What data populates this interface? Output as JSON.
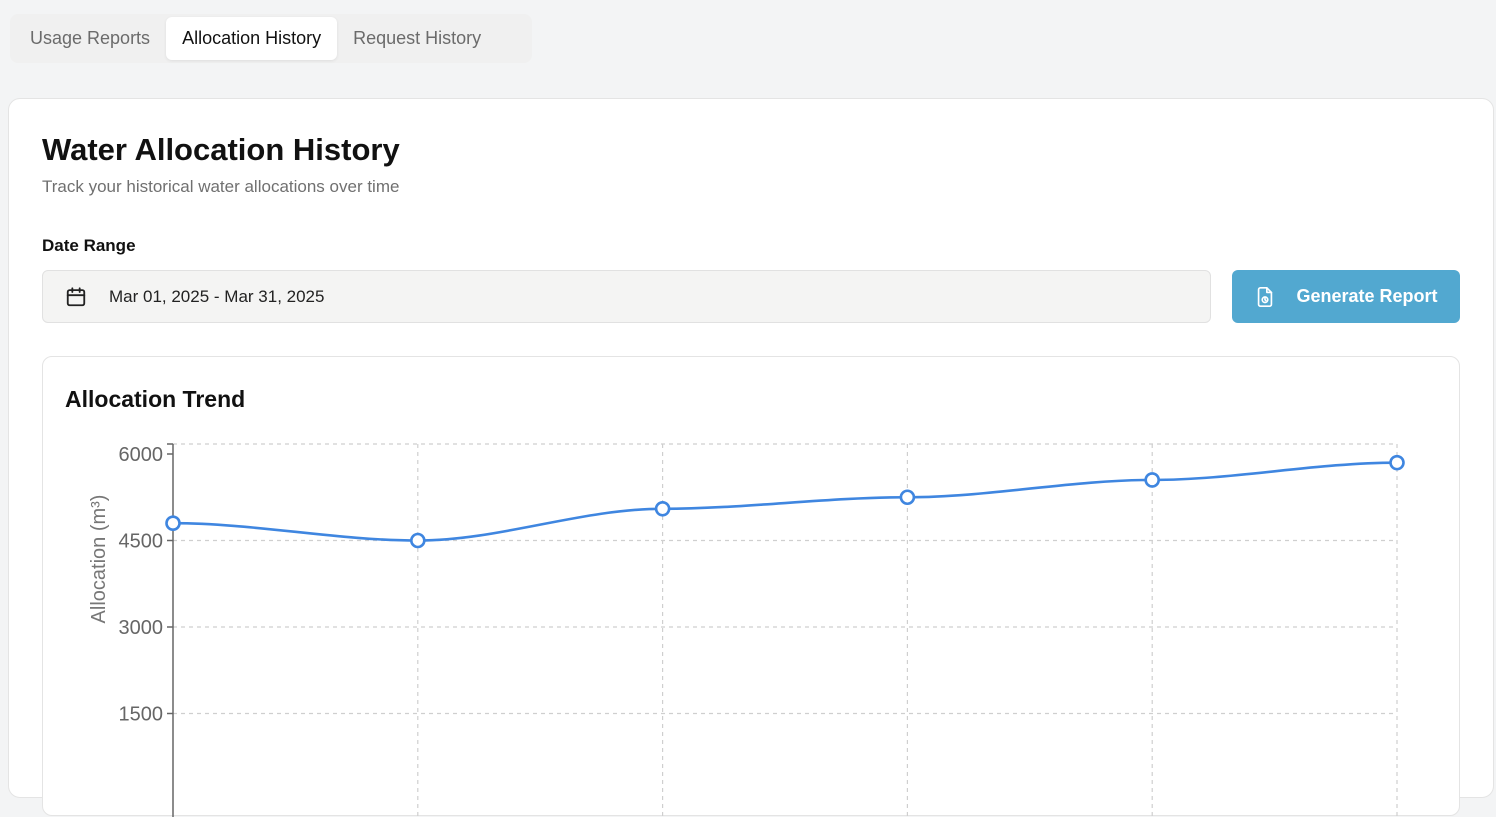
{
  "tabs": [
    {
      "label": "Usage Reports",
      "active": false
    },
    {
      "label": "Allocation History",
      "active": true
    },
    {
      "label": "Request History",
      "active": false
    }
  ],
  "page": {
    "title": "Water Allocation History",
    "subtitle": "Track your historical water allocations over time"
  },
  "date_range": {
    "label": "Date Range",
    "value": "Mar 01, 2025 - Mar 31, 2025",
    "icon": "calendar-icon"
  },
  "generate_button": {
    "label": "Generate Report",
    "icon": "report-file-icon"
  },
  "colors": {
    "accent": "#52a8d0",
    "line": "#3f86e0"
  },
  "chart_title": "Allocation Trend",
  "chart_data": {
    "type": "line",
    "title": "Allocation Trend",
    "xlabel": "",
    "ylabel": "Allocation (m³)",
    "ylim": [
      0,
      6000
    ],
    "y_ticks": [
      1500,
      3000,
      4500,
      6000
    ],
    "grid": true,
    "series": [
      {
        "values": [
          4800,
          4500,
          5050,
          5250,
          5550,
          5850
        ]
      }
    ]
  }
}
